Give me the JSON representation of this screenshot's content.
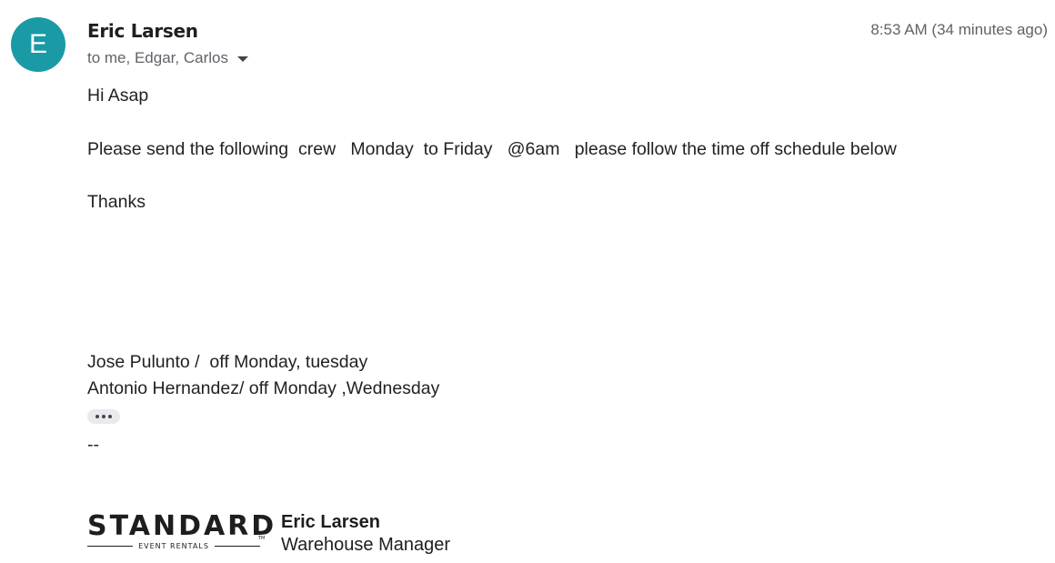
{
  "message": {
    "avatar_letter": "E",
    "avatar_color": "#1a9aa5",
    "sender_name": "Eric Larsen",
    "recipients": "to me, Edgar, Carlos",
    "timestamp": "8:53 AM (34 minutes ago)"
  },
  "body": {
    "greeting": "Hi Asap",
    "line1": "Please send the following  crew   Monday  to Friday   @6am   please follow the time off schedule below",
    "thanks": "Thanks",
    "schedule": [
      "Jose Pulunto /  off Monday, tuesday",
      "Antonio Hernandez/ off Monday ,Wednesday"
    ],
    "signature_separator": "--"
  },
  "signature": {
    "logo_word": "STANDARD",
    "logo_subtext": "EVENT RENTALS",
    "logo_tm": "TM",
    "name": "Eric Larsen",
    "title": "Warehouse Manager"
  }
}
